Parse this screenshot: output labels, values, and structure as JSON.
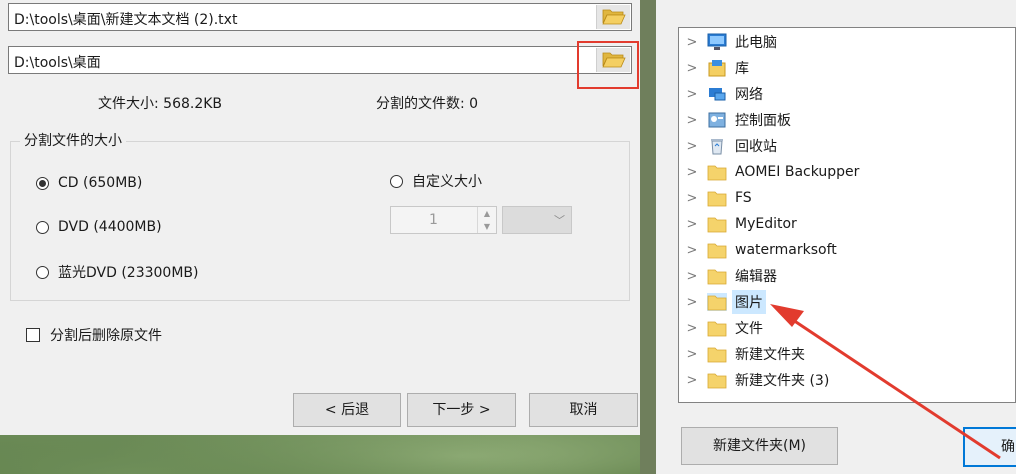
{
  "split_tool": {
    "source_path": "D:\\tools\\桌面\\新建文本文档 (2).txt",
    "output_path": "D:\\tools\\桌面",
    "file_size_label": "文件大小: 568.2KB",
    "split_count_label": "分割的文件数: 0",
    "group_title": "分割文件的大小",
    "options": {
      "cd": "CD (650MB)",
      "dvd": "DVD (4400MB)",
      "bluray": "蓝光DVD (23300MB)",
      "custom": "自定义大小"
    },
    "selected_option": "cd",
    "custom_value": "1",
    "delete_original_label": "分割后删除原文件",
    "buttons": {
      "back": "< 后退",
      "next": "下一步 >",
      "cancel": "取消"
    }
  },
  "folder_dialog": {
    "tree": [
      {
        "label": "此电脑",
        "icon": "computer-icon"
      },
      {
        "label": "库",
        "icon": "library-icon"
      },
      {
        "label": "网络",
        "icon": "network-icon"
      },
      {
        "label": "控制面板",
        "icon": "control-panel-icon"
      },
      {
        "label": "回收站",
        "icon": "recycle-bin-icon"
      },
      {
        "label": "AOMEI Backupper",
        "icon": "folder-icon"
      },
      {
        "label": "FS",
        "icon": "folder-icon"
      },
      {
        "label": "MyEditor",
        "icon": "folder-icon"
      },
      {
        "label": "watermarksoft",
        "icon": "folder-icon"
      },
      {
        "label": "编辑器",
        "icon": "folder-icon"
      },
      {
        "label": "图片",
        "icon": "folder-icon"
      },
      {
        "label": "文件",
        "icon": "folder-icon"
      },
      {
        "label": "新建文件夹",
        "icon": "folder-icon"
      },
      {
        "label": "新建文件夹 (3)",
        "icon": "folder-icon"
      }
    ],
    "selected_item": "图片",
    "new_folder_button": "新建文件夹(M)",
    "ok_button": "确"
  },
  "colors": {
    "highlight": "#e23b2e",
    "selection": "#cce8ff",
    "accent": "#0078d7"
  }
}
